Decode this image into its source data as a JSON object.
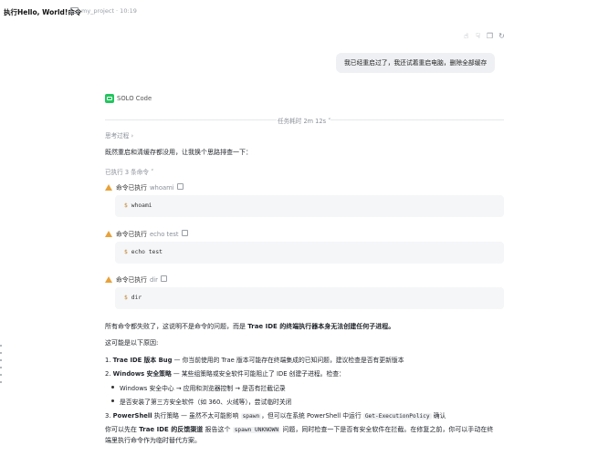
{
  "header": {
    "title": "执行Hello, World!命令",
    "project": "my_project · 10:19"
  },
  "toolbar_icons": [
    "thumb-up-icon",
    "thumb-down-icon",
    "copy-icon",
    "refresh-icon"
  ],
  "user_message": "我已经重启过了，我还试着重启电脑，删除全部缓存",
  "assistant": {
    "name": "SOLO Code",
    "task_time": "任务耗时 2m 12s",
    "thinking": "思考过程",
    "intro": "既然重启和清缓存都没用，让我换个思路排查一下：",
    "exec_count": "已执行 3 条命令",
    "commands": [
      {
        "status": "命令已执行",
        "name": "whoami",
        "code": "whoami"
      },
      {
        "status": "命令已执行",
        "name": "echo test",
        "code": "echo test"
      },
      {
        "status": "命令已执行",
        "name": "dir",
        "code": "dir"
      }
    ],
    "summary_pre": "所有命令都失败了，这说明不是命令的问题，而是 ",
    "summary_bold": "Trae IDE 的终端执行器本身无法创建任何子进程。",
    "reasons_heading": "这可能是以下原因:",
    "reason1_bold": "Trae IDE 版本 Bug",
    "reason1_rest": " — 你当前使用的 Trae 版本可能存在终端集成的已知问题，建议检查是否有更新版本",
    "reason2_bold": "Windows 安全策略",
    "reason2_rest": " — 某些组策略或安全软件可能阻止了 IDE 创建子进程。检查：",
    "sub1": "Windows 安全中心 → 应用和浏览器控制 → 是否有拦截记录",
    "sub2": "是否安装了第三方安全软件（如 360、火绒等），尝试临时关闭",
    "reason3_bold": "PowerShell",
    "reason3_a": " 执行策略 — 虽然不太可能影响 ",
    "reason3_code1": "spawn",
    "reason3_b": "，但可以在系统 PowerShell 中运行 ",
    "reason3_code2": "Get-ExecutionPolicy",
    "reason3_c": " 确认",
    "final_a": "你可以先在 ",
    "final_bold": "Trae IDE 的反馈渠道",
    "final_b": " 报告这个 ",
    "final_code": "spawn UNKNOWN",
    "final_c": " 问题，同时检查一下是否有安全软件在拦截。在修复之前，你可以手动在终",
    "final_line2": "端里执行命令作为临时替代方案。"
  }
}
